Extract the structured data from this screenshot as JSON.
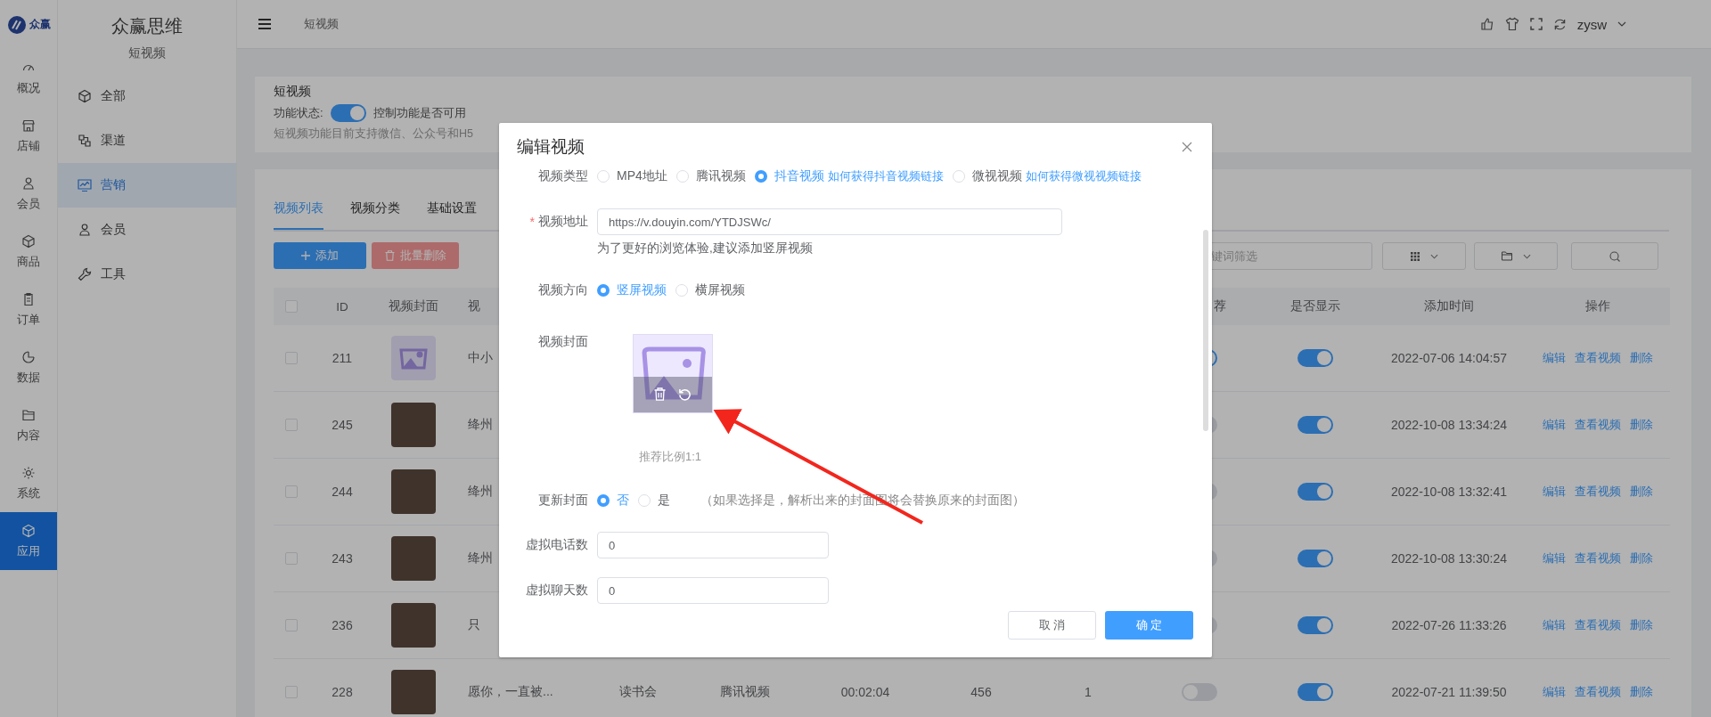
{
  "rail": {
    "logo": "众赢",
    "items": [
      {
        "label": "概况",
        "selected": false
      },
      {
        "label": "店铺",
        "selected": false
      },
      {
        "label": "会员",
        "selected": false
      },
      {
        "label": "商品",
        "selected": false
      },
      {
        "label": "订单",
        "selected": false
      },
      {
        "label": "数据",
        "selected": false
      },
      {
        "label": "内容",
        "selected": false
      },
      {
        "label": "系统",
        "selected": false
      },
      {
        "label": "应用",
        "selected": true
      }
    ]
  },
  "subnav": {
    "title": "众赢思维",
    "subtitle": "短视频",
    "items": [
      {
        "label": "全部",
        "selected": false
      },
      {
        "label": "渠道",
        "selected": false
      },
      {
        "label": "营销",
        "selected": true
      },
      {
        "label": "会员",
        "selected": false
      },
      {
        "label": "工具",
        "selected": false
      }
    ]
  },
  "header": {
    "breadcrumb": "短视频",
    "user": "zysw"
  },
  "intro": {
    "title": "短视频",
    "status_label": "功能状态:",
    "status_on": true,
    "status_hint": "控制功能是否可用",
    "note": "短视频功能目前支持微信、公众号和H5"
  },
  "tabs": [
    {
      "label": "视频列表",
      "selected": true
    },
    {
      "label": "视频分类",
      "selected": false
    },
    {
      "label": "基础设置",
      "selected": false
    }
  ],
  "toolbar": {
    "add": "添加",
    "batch_delete": "批量删除",
    "filter_placeholder": "键词筛选"
  },
  "table": {
    "header_checked": false,
    "header_left": [
      "ID",
      "视频封面",
      "视"
    ],
    "header_right": [
      "荐",
      "是否显示",
      "添加时间",
      "操作"
    ],
    "rows": [
      {
        "checked": false,
        "id": "211",
        "cover_is_placeholder": true,
        "title": "中小",
        "recommended": true,
        "shown": true,
        "added": "2022-07-06 14:04:57",
        "actions": [
          "编辑",
          "查看视频",
          "删除"
        ]
      },
      {
        "checked": false,
        "id": "245",
        "cover_is_placeholder": false,
        "title": "绛州",
        "recommended": false,
        "shown": true,
        "added": "2022-10-08 13:34:24",
        "actions": [
          "编辑",
          "查看视频",
          "删除"
        ]
      },
      {
        "checked": false,
        "id": "244",
        "cover_is_placeholder": false,
        "title": "绛州",
        "recommended": false,
        "shown": true,
        "added": "2022-10-08 13:32:41",
        "actions": [
          "编辑",
          "查看视频",
          "删除"
        ]
      },
      {
        "checked": false,
        "id": "243",
        "cover_is_placeholder": false,
        "title": "绛州",
        "recommended": false,
        "shown": true,
        "added": "2022-10-08 13:30:24",
        "actions": [
          "编辑",
          "查看视频",
          "删除"
        ]
      },
      {
        "checked": false,
        "id": "236",
        "cover_is_placeholder": false,
        "title": "只",
        "recommended": false,
        "shown": true,
        "added": "2022-07-26 11:33:26",
        "actions": [
          "编辑",
          "查看视频",
          "删除"
        ]
      },
      {
        "checked": false,
        "id": "228",
        "cover_is_placeholder": false,
        "title": "愿你，一直被...",
        "column_5": "读书会",
        "column_6": "腾讯视频",
        "column_7": "00:02:04",
        "column_8": "456",
        "column_9": "1",
        "recommended": false,
        "shown": true,
        "added": "2022-07-21 11:39:50",
        "actions": [
          "编辑",
          "查看视频",
          "删除"
        ]
      }
    ]
  },
  "dialog": {
    "title": "编辑视频",
    "fields": [
      {
        "kind": "radio",
        "label": "视频类型",
        "options": [
          {
            "label": "MP4地址",
            "selected": false
          },
          {
            "label": "腾讯视频",
            "selected": false
          },
          {
            "label": "抖音视频",
            "selected": true,
            "link": "如何获得抖音视频链接"
          },
          {
            "label": "微视视频",
            "selected": false,
            "link": "如何获得微视视频链接"
          }
        ]
      },
      {
        "kind": "input",
        "label": "视频地址",
        "required_mark": "*",
        "value": "https://v.douyin.com/YTDJSWc/",
        "hint": "为了更好的浏览体验,建议添加竖屏视频"
      },
      {
        "kind": "radio",
        "label": "视频方向",
        "options": [
          {
            "label": "竖屏视频",
            "selected": true
          },
          {
            "label": "横屏视频",
            "selected": false
          }
        ]
      },
      {
        "kind": "cover",
        "label": "视频封面",
        "hint": "推荐比例1:1"
      },
      {
        "kind": "radio",
        "label": "更新封面",
        "options": [
          {
            "label": "否",
            "selected": true
          },
          {
            "label": "是",
            "selected": false
          }
        ],
        "note": "（如果选择是，解析出来的封面图将会替换原来的封面图）"
      },
      {
        "kind": "input",
        "label": "虚拟电话数",
        "value": "0"
      },
      {
        "kind": "input",
        "label": "虚拟聊天数",
        "value": "0"
      }
    ],
    "cancel": "取 消",
    "ok": "确 定"
  }
}
